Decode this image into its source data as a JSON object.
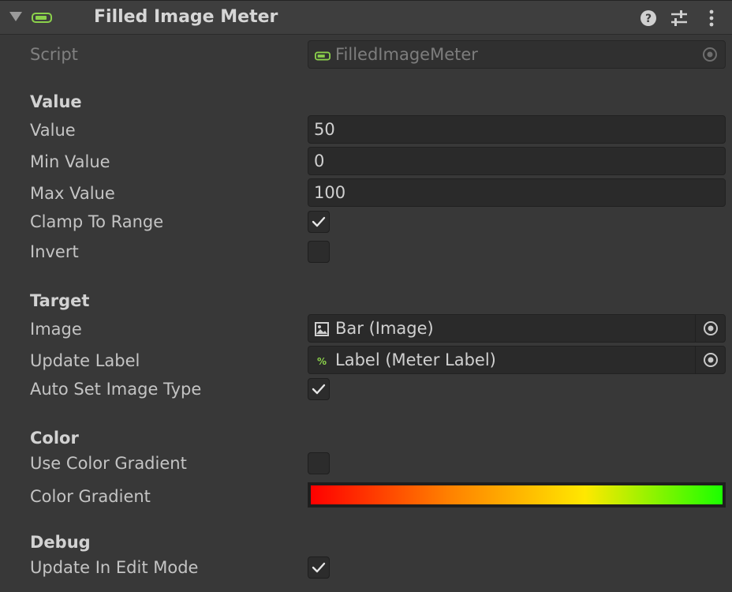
{
  "header": {
    "title": "Filled Image Meter",
    "component_icon": "meter-component-icon",
    "icons": [
      "help-icon",
      "settings-icon",
      "menu-icon"
    ]
  },
  "script": {
    "label": "Script",
    "value": "FilledImageMeter",
    "icon": "script-icon"
  },
  "sections": {
    "value": "Value",
    "target": "Target",
    "color": "Color",
    "debug": "Debug"
  },
  "value_section": {
    "value_label": "Value",
    "value": "50",
    "min_label": "Min Value",
    "min": "0",
    "max_label": "Max Value",
    "max": "100",
    "clamp_label": "Clamp To Range",
    "clamp_checked": true,
    "invert_label": "Invert",
    "invert_checked": false
  },
  "target_section": {
    "image_label": "Image",
    "image_value": "Bar (Image)",
    "image_icon": "image-icon",
    "update_label_label": "Update Label",
    "update_label_value": "Label (Meter Label)",
    "update_label_icon": "percent-script-icon",
    "auto_set_label": "Auto Set Image Type",
    "auto_set_checked": true
  },
  "color_section": {
    "use_gradient_label": "Use Color Gradient",
    "use_gradient_checked": false,
    "gradient_label": "Color Gradient",
    "gradient_stops": [
      "#ff0000",
      "#ff8000",
      "#ffe800",
      "#1bff00"
    ]
  },
  "debug_section": {
    "update_edit_label": "Update In Edit Mode",
    "update_edit_checked": true
  },
  "colors": {
    "background": "#383838",
    "accent": "#8bd14b",
    "field_bg": "#2a2a2a"
  }
}
